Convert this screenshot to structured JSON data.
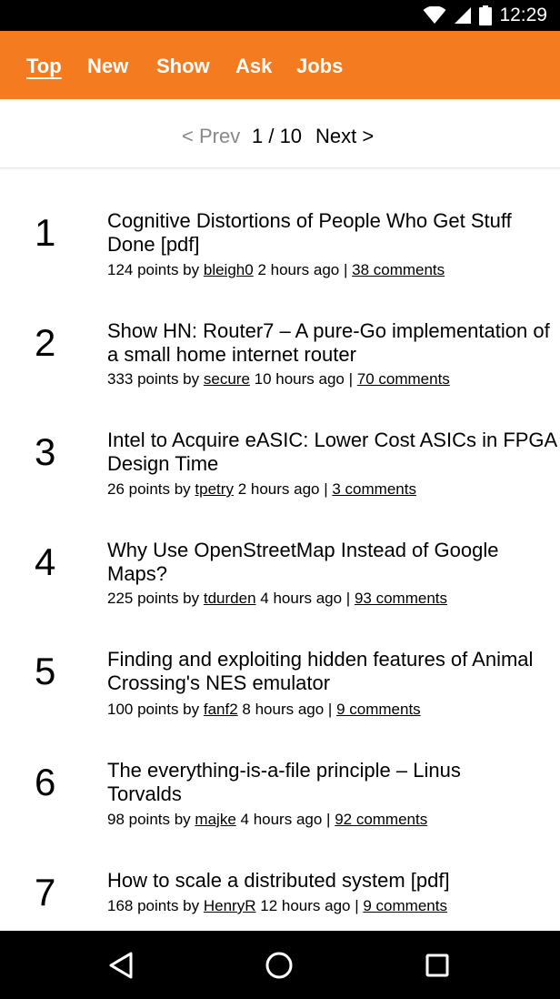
{
  "status_bar": {
    "time": "12:29"
  },
  "nav": {
    "tabs": [
      {
        "label": "Top",
        "active": true
      },
      {
        "label": "New"
      },
      {
        "label": "Show"
      },
      {
        "label": "Ask"
      },
      {
        "label": "Jobs"
      }
    ]
  },
  "pager": {
    "prev": "< Prev",
    "page": "1 / 10",
    "next": "Next >"
  },
  "stories": [
    {
      "rank": "1",
      "title": "Cognitive Distortions of People Who Get Stuff Done [pdf]",
      "points": "124 points by",
      "user": "bleigh0",
      "time": "2 hours ago |",
      "comments": "38 comments"
    },
    {
      "rank": "2",
      "title": "Show HN: Router7 – A pure-Go implementation of a small home internet router",
      "points": "333 points by",
      "user": "secure",
      "time": "10 hours ago |",
      "comments": "70 comments"
    },
    {
      "rank": "3",
      "title": "Intel to Acquire eASIC: Lower Cost ASICs in FPGA Design Time",
      "points": "26 points by",
      "user": "tpetry",
      "time": "2 hours ago |",
      "comments": "3 comments"
    },
    {
      "rank": "4",
      "title": "Why Use OpenStreetMap Instead of Google Maps?",
      "points": "225 points by",
      "user": "tdurden",
      "time": "4 hours ago |",
      "comments": "93 comments"
    },
    {
      "rank": "5",
      "title": "Finding and exploiting hidden features of Animal Crossing's NES emulator",
      "points": "100 points by",
      "user": "fanf2",
      "time": "8 hours ago |",
      "comments": "9 comments"
    },
    {
      "rank": "6",
      "title": "The everything-is-a-file principle – Linus Torvalds",
      "points": "98 points by",
      "user": "majke",
      "time": "4 hours ago |",
      "comments": "92 comments"
    },
    {
      "rank": "7",
      "title": "How to scale a distributed system [pdf]",
      "points": "168 points by",
      "user": "HenryR",
      "time": "12 hours ago |",
      "comments": "9 comments"
    }
  ],
  "colors": {
    "brand": "#f47b20",
    "prev_disabled": "#888888"
  },
  "icons": {
    "wifi": "wifi-icon",
    "signal": "signal-icon",
    "battery": "battery-icon",
    "back": "back-icon",
    "home": "home-icon",
    "recents": "recents-icon"
  }
}
